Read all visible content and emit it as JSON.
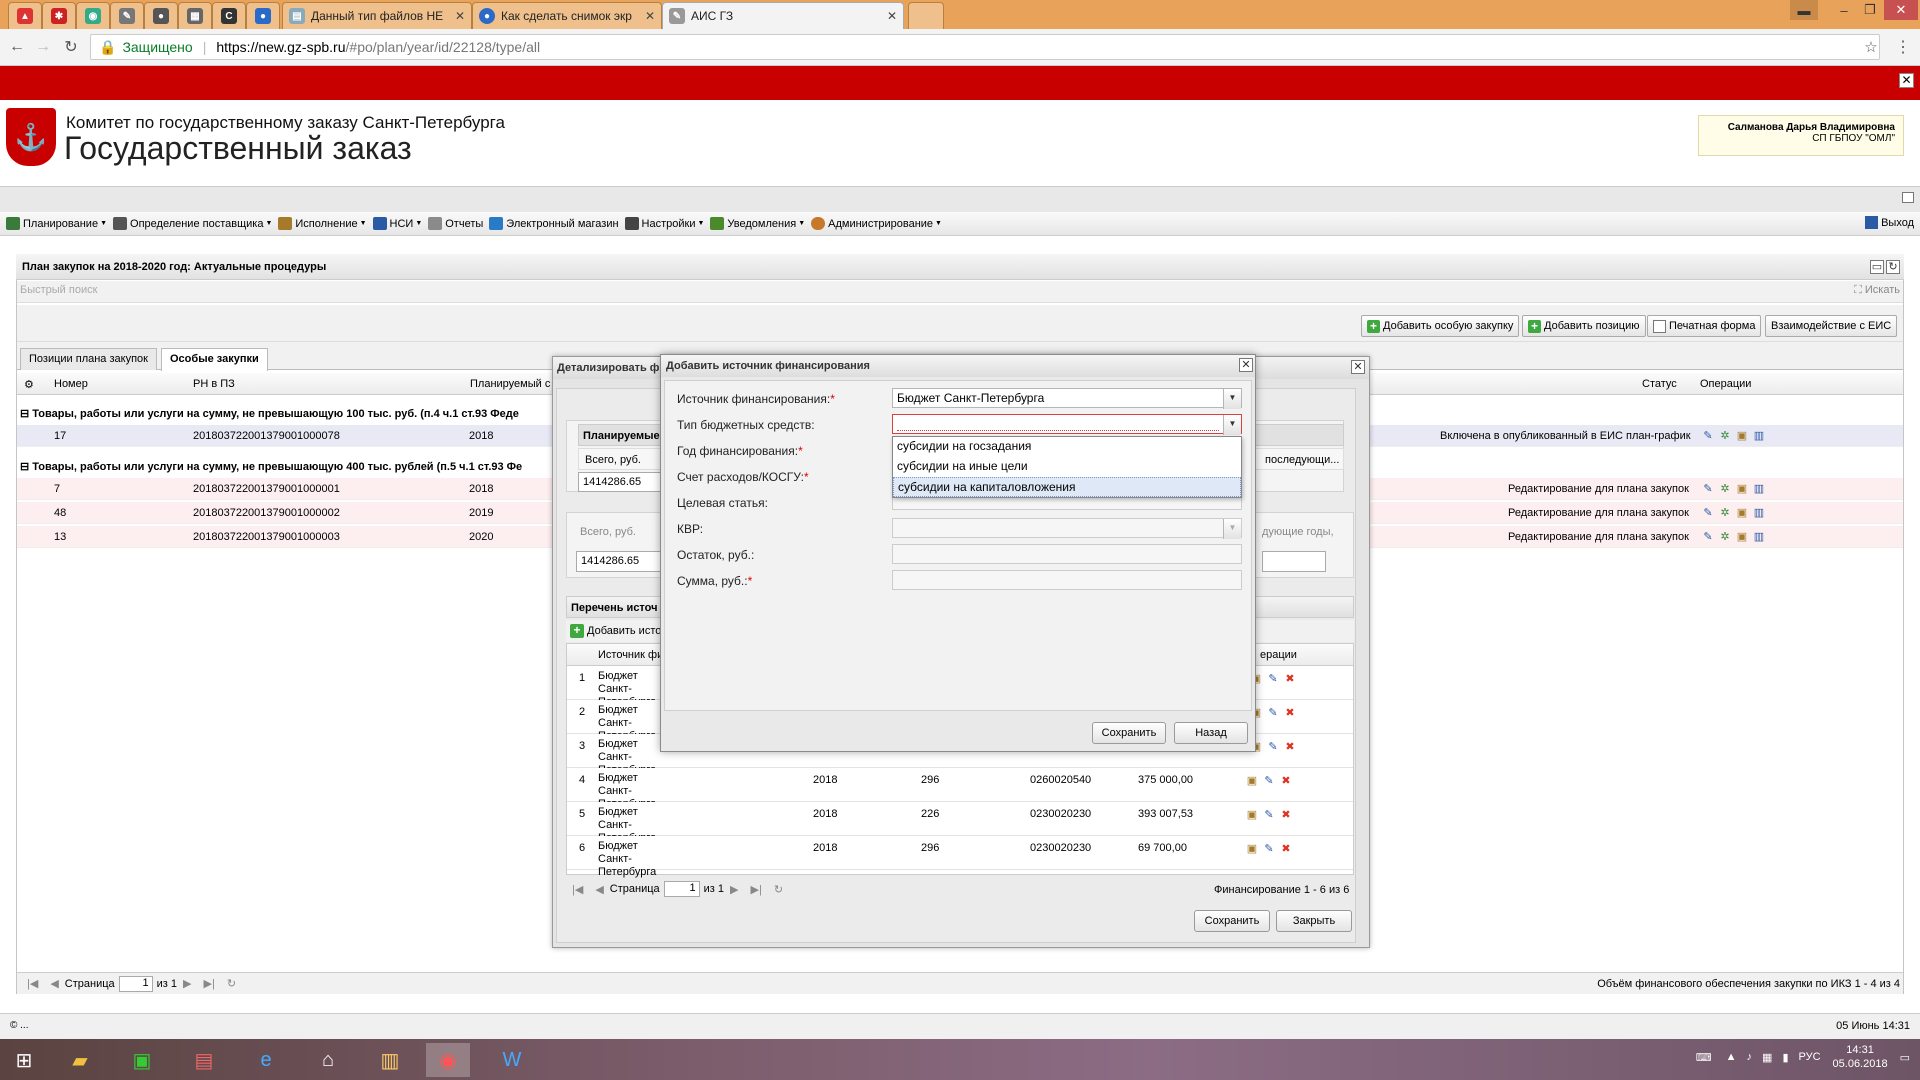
{
  "browser": {
    "tabs": [
      {
        "title": "Данный тип файлов НЕ"
      },
      {
        "title": "Как сделать снимок экр"
      },
      {
        "title": "АИС ГЗ"
      }
    ],
    "address": {
      "secure_label": "Защищено",
      "url_host": "https://new.gz-spb.ru",
      "url_path": "/#po/plan/year/id/22128/type/all"
    }
  },
  "header": {
    "org_name": "Комитет по государственному заказу Санкт-Петербурга",
    "system_name": "Государственный заказ",
    "user_name": "Салманова Дарья Владимировна",
    "user_org": "СП ГБПОУ \"ОМЛ\""
  },
  "menu": {
    "items": [
      {
        "label": "Планирование",
        "icon": "table-icon",
        "color": "#3a7a3a"
      },
      {
        "label": "Определение поставщика",
        "icon": "gears-icon",
        "color": "#555555"
      },
      {
        "label": "Исполнение",
        "icon": "boxes-icon",
        "color": "#a57a2a"
      },
      {
        "label": "НСИ",
        "icon": "book-icon",
        "color": "#2a5aa5"
      },
      {
        "label": "Отчеты",
        "icon": "report-icon",
        "color": "#8a8a8a"
      },
      {
        "label": "Электронный магазин",
        "icon": "shop-icon",
        "color": "#2a7ac8"
      },
      {
        "label": "Настройки",
        "icon": "wrench-icon",
        "color": "#444444"
      },
      {
        "label": "Уведомления",
        "icon": "envelope-icon",
        "color": "#4a8a2a"
      },
      {
        "label": "Администрирование",
        "icon": "user-icon",
        "color": "#c8782a"
      }
    ],
    "exit_label": "Выход"
  },
  "panel": {
    "title": "План закупок на 2018-2020 год: Актуальные процедуры",
    "search_placeholder": "Быстрый поиск",
    "search_button": "Искать",
    "toolbar": {
      "add_special": "Добавить особую закупку",
      "add_position": "Добавить позицию",
      "print_form": "Печатная форма",
      "eis": "Взаимодействие с ЕИС"
    },
    "tabs": [
      "Позиции плана закупок",
      "Особые закупки"
    ],
    "columns": {
      "number": "Номер",
      "rn": "РН в ПЗ",
      "planned": "Планируемый с",
      "status": "Статус",
      "ops": "Операции"
    },
    "groups": [
      {
        "title": "Товары, работы или услуги на сумму, не превышающую 100 тыс. руб. (п.4 ч.1 ст.93 Феде",
        "rows": [
          {
            "number": "17",
            "rn": "201803722001379001000078",
            "year": "2018",
            "status": "Включена в опубликованный в ЕИС план-график"
          }
        ]
      },
      {
        "title": "Товары, работы или услуги на сумму, не превышающую 400 тыс. рублей (п.5 ч.1 ст.93 Фе",
        "rows": [
          {
            "number": "7",
            "rn": "201803722001379001000001",
            "year": "2018",
            "status": "Редактирование для плана закупок"
          },
          {
            "number": "48",
            "rn": "201803722001379001000002",
            "year": "2019",
            "status": "Редактирование для плана закупок"
          },
          {
            "number": "13",
            "rn": "201803722001379001000003",
            "year": "2020",
            "status": "Редактирование для плана закупок"
          }
        ]
      }
    ],
    "pager": {
      "page_label": "Страница",
      "page": "1",
      "of": "из 1",
      "info": "Объём финансового обеспечения закупки по ИКЗ 1 - 4 из 4"
    }
  },
  "detail_dialog": {
    "title": "Детализировать ф",
    "planned_label": "Планируемые",
    "total_label": "Всего, руб.",
    "total_value": "1414286.65",
    "next_years_label": "последующи...",
    "total_label2": "Всего, руб.",
    "total_value2": "1414286.65",
    "next_years_label2": "дующие годы,",
    "sources_title": "Перечень источ",
    "add_source": "Добавить исто",
    "grid_head_source": "Источник фи",
    "grid_head_ops": "ерации",
    "rows": [
      {
        "n": "1",
        "source": "Бюджет Санкт-Петербурга",
        "year": "",
        "code": "",
        "kbk": "",
        "sum": ""
      },
      {
        "n": "2",
        "source": "Бюджет Санкт-Петербурга",
        "year": "",
        "code": "",
        "kbk": "",
        "sum": ""
      },
      {
        "n": "3",
        "source": "Бюджет Санкт-Петербурга",
        "year": "",
        "code": "",
        "kbk": "",
        "sum": ""
      },
      {
        "n": "4",
        "source": "Бюджет Санкт-Петербурга",
        "year": "2018",
        "code": "296",
        "kbk": "0260020540",
        "sum": "375 000,00"
      },
      {
        "n": "5",
        "source": "Бюджет Санкт-Петербурга",
        "year": "2018",
        "code": "226",
        "kbk": "0230020230",
        "sum": "393 007,53"
      },
      {
        "n": "6",
        "source": "Бюджет Санкт-Петербурга",
        "year": "2018",
        "code": "296",
        "kbk": "0230020230",
        "sum": "69 700,00"
      }
    ],
    "pager": {
      "page_label": "Страница",
      "page": "1",
      "of": "из 1",
      "info": "Финансирование 1 - 6 из 6"
    },
    "save": "Сохранить",
    "close": "Закрыть"
  },
  "add_dialog": {
    "title": "Добавить источник финансирования",
    "fields": {
      "source_label": "Источник финансирования:",
      "source_value": "Бюджет Санкт-Петербурга",
      "budget_type_label": "Тип бюджетных средств:",
      "year_label": "Год финансирования:",
      "account_label": "Счет расходов/КОСГУ:",
      "target_label": "Целевая статья:",
      "kvr_label": "КВР:",
      "balance_label": "Остаток, руб.:",
      "sum_label": "Сумма, руб.:"
    },
    "dropdown_options": [
      "субсидии на госзадания",
      "субсидии на иные цели",
      "субсидии на капиталовложения"
    ],
    "save": "Сохранить",
    "back": "Назад"
  },
  "status": {
    "left": "© ...",
    "right": "05 Июнь 14:31"
  },
  "taskbar": {
    "lang": "РУС",
    "time": "14:31",
    "date": "05.06.2018"
  }
}
